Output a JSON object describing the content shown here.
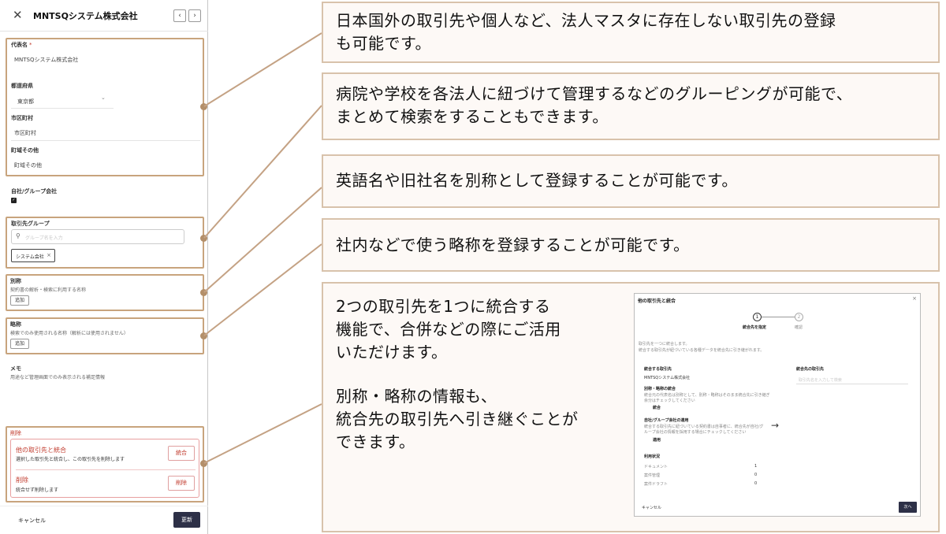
{
  "panel": {
    "title": "MNTSQシステム株式会社",
    "prev_icon": "‹",
    "next_icon": "›",
    "fields": {
      "representative": {
        "label": "代表名",
        "required_mark": "*",
        "value": "MNTSQシステム株式会社"
      },
      "prefecture": {
        "label": "都道府県",
        "value": "東京都",
        "dropdown_icon": "⌄"
      },
      "city": {
        "label": "市区町村",
        "value": "市区町村"
      },
      "town": {
        "label": "町域その他",
        "value": "町域その他"
      }
    },
    "own_group": {
      "label": "自社/グループ会社",
      "checked": true,
      "check_mark": "✓"
    },
    "client_group": {
      "label": "取引先グループ",
      "search_icon": "search-icon",
      "search_placeholder": "グループ名を入力",
      "chip_label": "システム会社",
      "chip_remove": "×"
    },
    "alias": {
      "label": "別称",
      "hint": "契約書の解析・検索に利用する名称",
      "add_label": "追加"
    },
    "abbr": {
      "label": "略称",
      "hint": "検索でのみ使用される名称（解析には使用されません）",
      "add_label": "追加"
    },
    "memo": {
      "label": "メモ",
      "hint": "用途など管理画面でのみ表示される補足情報"
    },
    "delete_section": {
      "title": "削除",
      "merge": {
        "title": "他の取引先と統合",
        "desc": "選択した取引先と統合し、この取引先を削除します",
        "button": "統合"
      },
      "delete": {
        "title": "削除",
        "desc": "統合せず削除します",
        "button": "削除"
      }
    },
    "footer": {
      "cancel": "キャンセル",
      "update": "更新"
    }
  },
  "callouts": [
    {
      "lines": [
        "日本国外の取引先や個人など、法人マスタに存在しない取引先の登録",
        "も可能です。"
      ]
    },
    {
      "lines": [
        "病院や学校を各法人に紐づけて管理するなどのグルーピングが可能で、",
        "まとめて検索をすることもできます。"
      ]
    },
    {
      "lines": [
        "英語名や旧社名を別称として登録することが可能です。"
      ]
    },
    {
      "lines": [
        "社内などで使う略称を登録することが可能です。"
      ]
    },
    {
      "lines": [
        "2つの取引先を1つに統合する",
        "機能で、合併などの際にご活用",
        "いただけます。",
        "",
        "別称・略称の情報も、",
        "統合先の取引先へ引き継ぐことが",
        "できます。"
      ]
    }
  ],
  "merge_dialog": {
    "title": "他の取引先と統合",
    "close": "×",
    "step1_num": "1",
    "step1_label": "統合先を指定",
    "step2_num": "2",
    "step2_label": "確認",
    "intro1": "取引先を一つに統合します。",
    "intro2": "統合する取引先が紐づいている各種データを統合先に引き継がれます。",
    "source_label": "統合する取引先",
    "source_value": "MNTSQシステム株式会社",
    "alias_label": "別称・略称の統合",
    "alias_desc1": "統合元の代表名は別称として、別称・略称はそのまま統合先に引き継ぎ",
    "alias_desc2": "余分はチェックしてください",
    "alias_value": "統合",
    "group_label": "自社/グループ会社の適用",
    "group_desc1": "統合する取引先に紐づいている契約書は自事者に、統合先が自社/グ",
    "group_desc2": "ループ会社の情報を採用する場合にチェックしてください",
    "group_value": "適用",
    "usage_label": "利用状況",
    "usage_rows": [
      {
        "name": "ドキュメント",
        "count": "1"
      },
      {
        "name": "案件管理",
        "count": "0"
      },
      {
        "name": "案件ドラフト",
        "count": "0"
      }
    ],
    "target_label": "統合先の取引先",
    "target_placeholder": "取引先名を入力して検索",
    "arrow": "→",
    "cancel": "キャンセル",
    "next": "次へ"
  },
  "colors": {
    "callout_border": "#d8c2ab",
    "callout_bg": "#fdf9f6",
    "highlight_border": "#c8a47d",
    "connector": "#c4a284",
    "danger": "#c0392b",
    "primary_button": "#2d3047"
  }
}
